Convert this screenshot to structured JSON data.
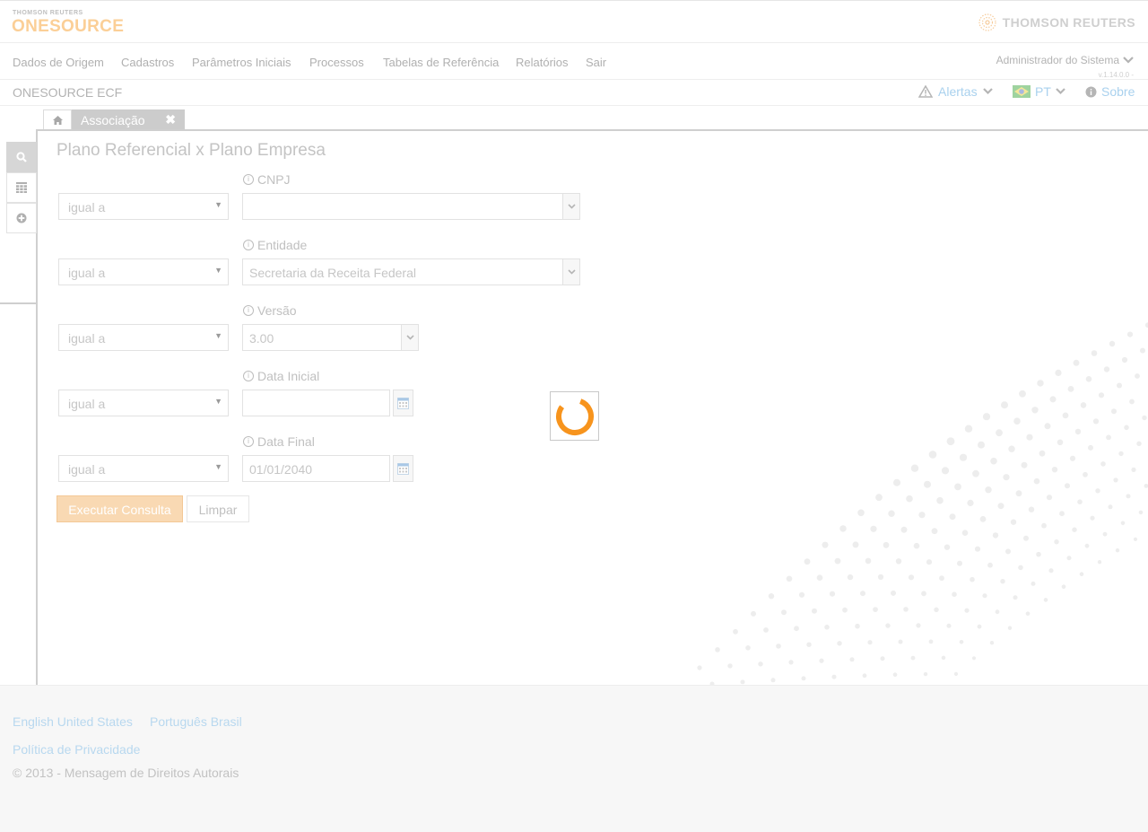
{
  "header": {
    "brand_small": "THOMSON REUTERS",
    "brand_product": "ONESOURCE",
    "brand_right": "THOMSON REUTERS"
  },
  "nav": {
    "items": [
      "Dados de Origem",
      "Cadastros",
      "Parâmetros Iniciais",
      "Processos",
      "Tabelas de Referência",
      "Relatórios",
      "Sair"
    ],
    "user": "Administrador do Sistema",
    "version": "v.1.14.0.0 -"
  },
  "subbar": {
    "app_name": "ONESOURCE ECF",
    "alerts": "Alertas",
    "language": "PT",
    "about": "Sobre"
  },
  "tabs": {
    "home_icon": "home-icon",
    "active": "Associação"
  },
  "sidebar": {
    "icons": [
      "search-icon",
      "grid-icon",
      "add-circle-icon"
    ]
  },
  "form": {
    "title": "Plano Referencial x Plano Empresa",
    "fields": [
      {
        "label": "CNPJ",
        "operator": "igual a",
        "value": ""
      },
      {
        "label": "Entidade",
        "operator": "igual a",
        "value": "Secretaria da Receita Federal"
      },
      {
        "label": "Versão",
        "operator": "igual a",
        "value": "3.00"
      },
      {
        "label": "Data Inicial",
        "operator": "igual a",
        "value": ""
      },
      {
        "label": "Data Final",
        "operator": "igual a",
        "value": "01/01/2040"
      }
    ],
    "run_button": "Executar Consulta",
    "clear_button": "Limpar"
  },
  "loading": {
    "state": "loading",
    "spinner_color": "#f7941d"
  },
  "footer": {
    "lang_en": "English United States",
    "lang_pt": "Português Brasil",
    "privacy": "Política de Privacidade",
    "copyright": "© 2013 - Mensagem de Direitos Autorais"
  },
  "colors": {
    "brand_orange": "#f7941d",
    "link_blue": "#a9d1ee"
  }
}
